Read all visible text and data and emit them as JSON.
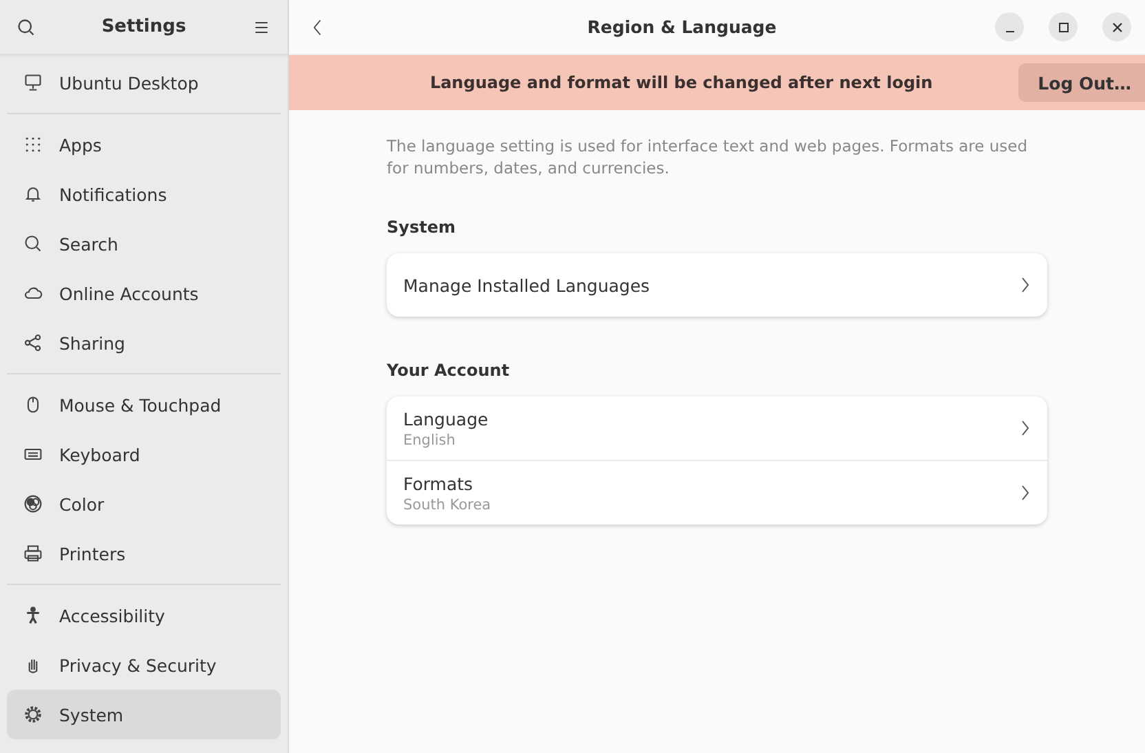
{
  "sidebar": {
    "title": "Settings",
    "groups": [
      [
        {
          "label": "Ubuntu Desktop",
          "kind": "desktop",
          "selected": false
        }
      ],
      [
        {
          "label": "Apps",
          "kind": "apps",
          "selected": false
        },
        {
          "label": "Notifications",
          "kind": "bell",
          "selected": false
        },
        {
          "label": "Search",
          "kind": "search",
          "selected": false
        },
        {
          "label": "Online Accounts",
          "kind": "cloud",
          "selected": false
        },
        {
          "label": "Sharing",
          "kind": "share",
          "selected": false
        }
      ],
      [
        {
          "label": "Mouse & Touchpad",
          "kind": "mouse",
          "selected": false
        },
        {
          "label": "Keyboard",
          "kind": "keyboard",
          "selected": false
        },
        {
          "label": "Color",
          "kind": "color",
          "selected": false
        },
        {
          "label": "Printers",
          "kind": "printer",
          "selected": false
        }
      ],
      [
        {
          "label": "Accessibility",
          "kind": "person",
          "selected": false
        },
        {
          "label": "Privacy & Security",
          "kind": "hand",
          "selected": false
        },
        {
          "label": "System",
          "kind": "gear",
          "selected": true
        }
      ]
    ]
  },
  "window": {
    "title": "Region & Language"
  },
  "banner": {
    "message": "Language and format will be changed after next login",
    "button": "Log Out…"
  },
  "description": "The language setting is used for interface text and web pages. Formats are used for numbers, dates, and currencies.",
  "sections": [
    {
      "title": "System",
      "rows": [
        {
          "title": "Manage Installed Languages"
        }
      ]
    },
    {
      "title": "Your Account",
      "rows": [
        {
          "title": "Language",
          "subtitle": "English"
        },
        {
          "title": "Formats",
          "subtitle": "South Korea"
        }
      ]
    }
  ]
}
